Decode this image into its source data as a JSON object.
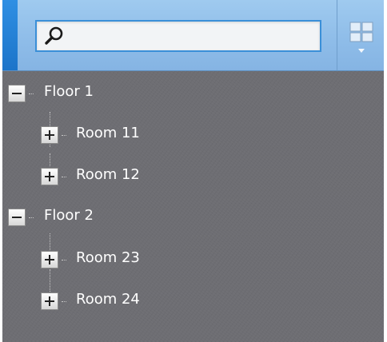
{
  "search": {
    "value": "",
    "placeholder": "",
    "icon": "search-icon"
  },
  "toolbar": {
    "view_icon": "grid-view-icon"
  },
  "colors": {
    "header_blue": "#8fbde9",
    "accent_blue": "#2f8fe3",
    "panel_gray": "#6e6e73",
    "label_text": "#ffffff"
  },
  "tree": {
    "floor_1": {
      "label": "Floor 1",
      "expanded": true,
      "room_11": {
        "label": "Room 11",
        "expanded": false
      },
      "room_12": {
        "label": "Room 12",
        "expanded": false
      }
    },
    "floor_2": {
      "label": "Floor 2",
      "expanded": true,
      "room_23": {
        "label": "Room 23",
        "expanded": false
      },
      "room_24": {
        "label": "Room 24",
        "expanded": false
      }
    }
  }
}
